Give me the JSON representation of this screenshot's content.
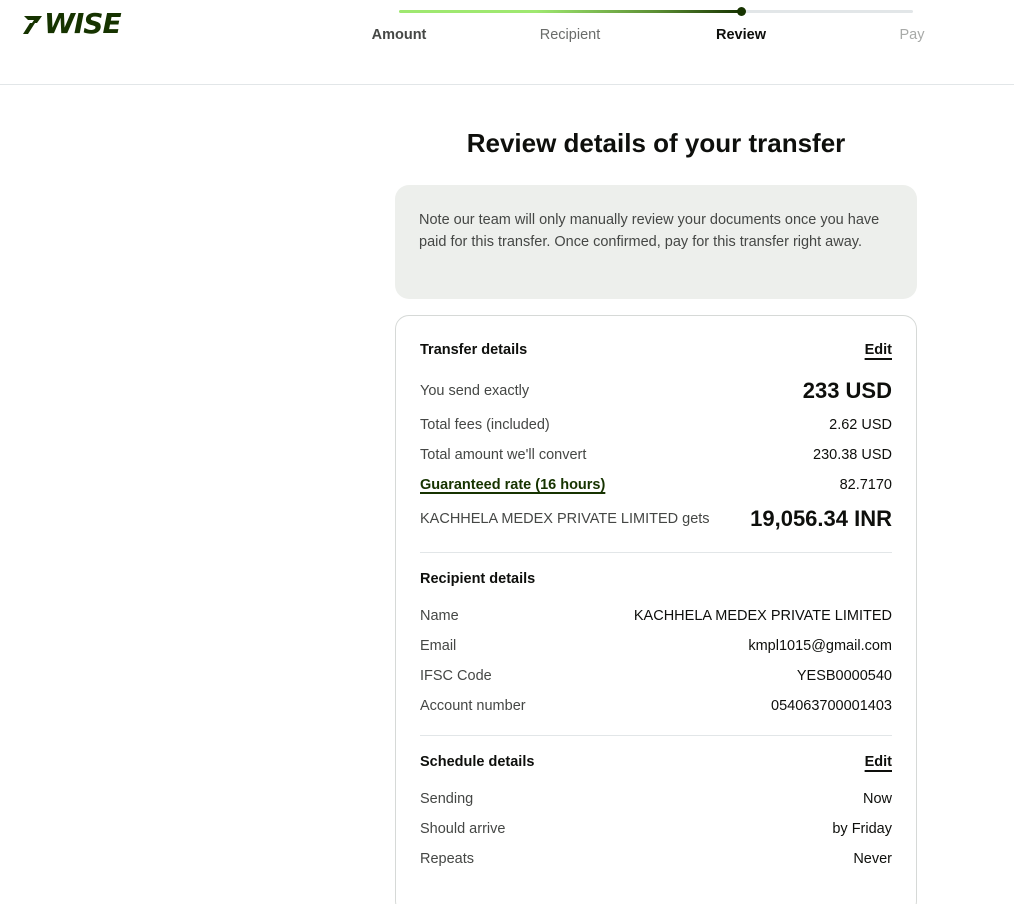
{
  "brand": {
    "name": "7WISE",
    "text": "WISE",
    "color": "#163300"
  },
  "stepper": {
    "steps": [
      {
        "label": "Amount",
        "state": "done"
      },
      {
        "label": "Recipient",
        "state": "done"
      },
      {
        "label": "Review",
        "state": "current"
      },
      {
        "label": "Pay",
        "state": "upcoming"
      }
    ],
    "progress_fraction": 0.667
  },
  "page": {
    "title": "Review details of your transfer"
  },
  "note": {
    "text": "Note our team will only manually review your documents once you have paid for this transfer. Once confirmed, pay for this transfer right away."
  },
  "transfer": {
    "section_title": "Transfer details",
    "edit_label": "Edit",
    "send_label": "You send exactly",
    "send_value": "233 USD",
    "fees_label": "Total fees (included)",
    "fees_value": "2.62 USD",
    "convert_label": "Total amount we'll convert",
    "convert_value": "230.38 USD",
    "rate_label": "Guaranteed rate (16 hours)",
    "rate_value": "82.7170",
    "gets_label": "KACHHELA MEDEX PRIVATE LIMITED gets",
    "gets_value": "19,056.34 INR"
  },
  "recipient": {
    "section_title": "Recipient details",
    "name_label": "Name",
    "name_value": "KACHHELA MEDEX PRIVATE LIMITED",
    "email_label": "Email",
    "email_value": "kmpl1015@gmail.com",
    "ifsc_label": "IFSC Code",
    "ifsc_value": "YESB0000540",
    "account_label": "Account number",
    "account_value": "054063700001403"
  },
  "schedule": {
    "section_title": "Schedule details",
    "edit_label": "Edit",
    "sending_label": "Sending",
    "sending_value": "Now",
    "arrive_label": "Should arrive",
    "arrive_value": "by Friday",
    "repeats_label": "Repeats",
    "repeats_value": "Never"
  },
  "colors": {
    "brand_dark": "#163300",
    "brand_green": "#9fe870",
    "note_bg": "#edefec",
    "text_primary": "#0e0f0c",
    "text_secondary": "#454745"
  }
}
